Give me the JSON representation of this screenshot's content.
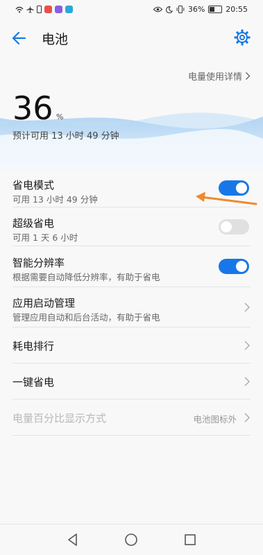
{
  "status_bar": {
    "battery_text": "36%",
    "time": "20:55",
    "icons": [
      "wifi-icon",
      "airplane-icon",
      "sim-icon",
      "weibo-icon",
      "app-icon",
      "app-icon",
      "eye-icon",
      "moon-icon",
      "vibrate-icon",
      "battery-icon"
    ]
  },
  "header": {
    "title": "电池",
    "back_icon": "arrow-left-icon",
    "settings_icon": "gear-icon"
  },
  "battery": {
    "usage_link": "电量使用详情",
    "percent_value": "36",
    "percent_unit": "%",
    "estimate": "预计可用 13 小时 49 分钟"
  },
  "settings": {
    "power_saving": {
      "label": "省电模式",
      "sub": "可用 13 小时 49 分钟",
      "on": true
    },
    "ultra_power_saving": {
      "label": "超级省电",
      "sub": "可用 1 天 6 小时",
      "on": false
    },
    "smart_resolution": {
      "label": "智能分辨率",
      "sub": "根据需要自动降低分辨率，有助于省电",
      "on": true
    },
    "app_launch": {
      "label": "应用启动管理",
      "sub": "管理应用自动和后台活动，有助于省电"
    },
    "consumption_rank": {
      "label": "耗电排行"
    },
    "one_key_save": {
      "label": "一键省电"
    },
    "percent_display": {
      "label": "电量百分比显示方式",
      "value": "电池图标外"
    }
  },
  "colors": {
    "accent": "#1877e8",
    "annotation_arrow": "#f08a2c"
  },
  "nav": {
    "icons": [
      "back-triangle-icon",
      "home-circle-icon",
      "recents-square-icon"
    ]
  }
}
